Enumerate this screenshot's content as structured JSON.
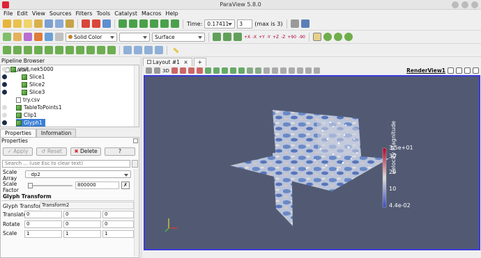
{
  "window": {
    "title": "ParaView 5.8.0"
  },
  "menu": [
    "File",
    "Edit",
    "View",
    "Sources",
    "Filters",
    "Tools",
    "Catalyst",
    "Macros",
    "Help"
  ],
  "time": {
    "label": "Time:",
    "value": "0.17411",
    "index": "3",
    "max_text": "(max is 3)"
  },
  "toolbar2": {
    "coloring": "Solid Color",
    "component": "",
    "representation": "Surface"
  },
  "camera_buttons": [
    "+X",
    "-X",
    "+Y",
    "-Y",
    "+Z",
    "-Z",
    "+90",
    "-90"
  ],
  "pipeline": {
    "title": "Pipeline Browser",
    "items": [
      {
        "label": "builtin:"
      },
      {
        "label": "visit.nek5000"
      },
      {
        "label": "Slice1"
      },
      {
        "label": "Slice2"
      },
      {
        "label": "Slice3"
      },
      {
        "label": "try.csv"
      },
      {
        "label": "TableToPoints1"
      },
      {
        "label": "Clip1"
      },
      {
        "label": "Glyph1"
      }
    ]
  },
  "tabs": {
    "properties": "Properties",
    "information": "Information"
  },
  "properties": {
    "header": "Properties",
    "apply": "Apply",
    "reset": "Reset",
    "delete": "Delete",
    "help": "?",
    "search_placeholder": "Search ... (use Esc to clear text)",
    "scale_array_label": "Scale\nArray",
    "scale_array_value": "dp2",
    "scale_factor_label": "Scale\nFactor",
    "scale_factor_value": "800000",
    "glyph_transform_section": "Glyph Transform",
    "glyph_transform_label": "Glyph Transform",
    "glyph_transform_value": "Transform2",
    "translate_label": "Translate",
    "translate": [
      "0",
      "0",
      "0"
    ],
    "rotate_label": "Rotate",
    "rotate": [
      "0",
      "0",
      "0"
    ],
    "scale_label": "Scale",
    "scale": [
      "1",
      "1",
      "1"
    ]
  },
  "layout_tab": {
    "label": "Layout #1",
    "add": "+"
  },
  "view": {
    "name": "RenderView1",
    "mode_3d": "3D"
  },
  "colorbar": {
    "title": "velocity Magnitude",
    "ticks": [
      "3.5e+01",
      "30",
      "20",
      "10",
      "4.4e-02"
    ]
  }
}
